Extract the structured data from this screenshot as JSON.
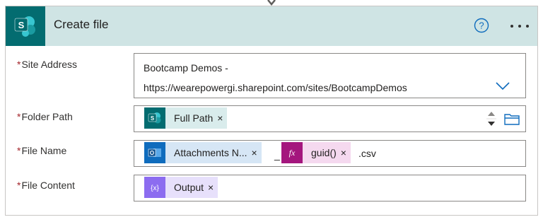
{
  "header": {
    "title": "Create file",
    "app_icon_letter": "S",
    "help_icon": "help-circle-icon",
    "more_icon": "more-horizontal-icon",
    "accent_color": "#036c70",
    "header_bg": "#cfe4e4"
  },
  "fields": [
    {
      "label": "Site Address",
      "required_mark": "*",
      "value_line1": "Bootcamp Demos -",
      "value_line2": "https://wearepowergi.sharepoint.com/sites/BootcampDemos",
      "dropdown_icon": "chevron-down-icon"
    },
    {
      "label": "Folder Path",
      "required_mark": "*",
      "tokens": [
        {
          "label": "Full Path",
          "icon": "sharepoint-icon",
          "color": "#036c70",
          "bg": "#d9ecec",
          "close": "×"
        }
      ],
      "picker_icon": "folder-icon"
    },
    {
      "label": "File Name",
      "required_mark": "*",
      "tokens": [
        {
          "label": "Attachments N...",
          "icon": "outlook-icon",
          "color": "#0f6cbd",
          "bg": "#d6e6f5",
          "close": "×"
        },
        {
          "label": "guid()",
          "icon": "expression-fx-icon",
          "color": "#a4167d",
          "bg": "#f5d9ef",
          "close": "×"
        }
      ],
      "separator": "_",
      "suffix": ".csv"
    },
    {
      "label": "File Content",
      "required_mark": "*",
      "tokens": [
        {
          "label": "Output",
          "icon": "variable-icon",
          "color": "#8c6cf0",
          "bg": "#e7e0fb",
          "close": "×"
        }
      ]
    }
  ]
}
